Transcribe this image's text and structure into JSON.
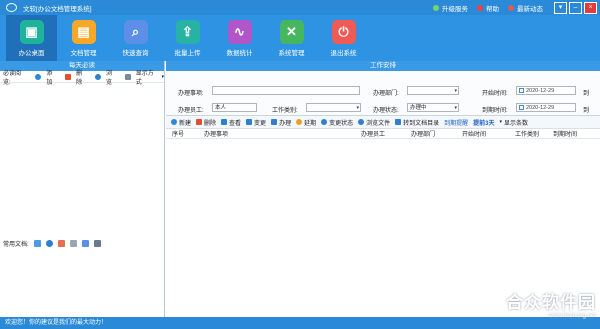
{
  "titlebar": {
    "title": "文软[办公文档管理系统]",
    "links": [
      {
        "label": "升级服务",
        "color": "#7ad36a"
      },
      {
        "label": "帮助",
        "color": "#f04040"
      },
      {
        "label": "最新动态",
        "color": "#e05a5a"
      }
    ],
    "win": [
      "▾",
      "–",
      "×"
    ]
  },
  "toolbar": [
    {
      "label": "办公桌面",
      "icon": "desktop-icon",
      "color": "#1fb39b",
      "glyph": "▣",
      "active": true
    },
    {
      "label": "文档管理",
      "icon": "document-icon",
      "color": "#f7a828",
      "glyph": "▤"
    },
    {
      "label": "快速查询",
      "icon": "search-icon",
      "color": "#5d8ee8",
      "glyph": "⌕"
    },
    {
      "label": "批量上传",
      "icon": "upload-icon",
      "color": "#27b3a3",
      "glyph": "⇪"
    },
    {
      "label": "数据统计",
      "icon": "chart-icon",
      "color": "#b056c9",
      "glyph": "∿"
    },
    {
      "label": "系统管理",
      "icon": "settings-icon",
      "color": "#46b75e",
      "glyph": "✕"
    },
    {
      "label": "退出系统",
      "icon": "exit-icon",
      "color": "#ef5a56",
      "glyph": "⏻"
    }
  ],
  "left": {
    "heading": "每天必读",
    "must_read_label": "必读阅览:",
    "add": "添加",
    "delete": "删除",
    "browse": "浏览",
    "display_mode": "显示方式",
    "docs_label": "常用文档:"
  },
  "right": {
    "heading": "工作安排",
    "form": {
      "item_label": "办理事项:",
      "dept_label": "办理部门:",
      "start_label": "开始时间:",
      "start_value": "2020-12-29",
      "to1": "到",
      "person_label": "办理员工:",
      "person_value": "本人",
      "type_label": "工作类别:",
      "status_label": "办理状态:",
      "status_value": "办理中",
      "due_label": "到期时间:",
      "due_value": "2020-12-29",
      "to2": "到"
    },
    "actions": [
      {
        "label": "新建",
        "color": "#2b8ad8"
      },
      {
        "label": "删除",
        "color": "#e0502f"
      },
      {
        "label": "查看",
        "color": "#2d7fcf"
      },
      {
        "label": "变更",
        "color": "#2f7ed0"
      },
      {
        "label": "办理",
        "color": "#2f7ed0"
      },
      {
        "label": "延期",
        "color": "#e4a22a"
      },
      {
        "label": "变更状态",
        "color": "#2f7ed0"
      },
      {
        "label": "浏览文件",
        "color": "#2f7ed0"
      },
      {
        "label": "转到文档目录",
        "color": "#2f7ed0"
      }
    ],
    "remind": "到期提醒",
    "days": "提前3天",
    "show_count": "显示条数",
    "columns": [
      "序号",
      "办理事项",
      "办理员工",
      "办理部门",
      "开始时间",
      "工作类别",
      "到期时间"
    ]
  },
  "status": {
    "text": "欢迎您！你的建议是我们的最大动力！"
  },
  "watermark": {
    "line1": "合众软件园",
    "line2": "www.hezhong.net"
  }
}
